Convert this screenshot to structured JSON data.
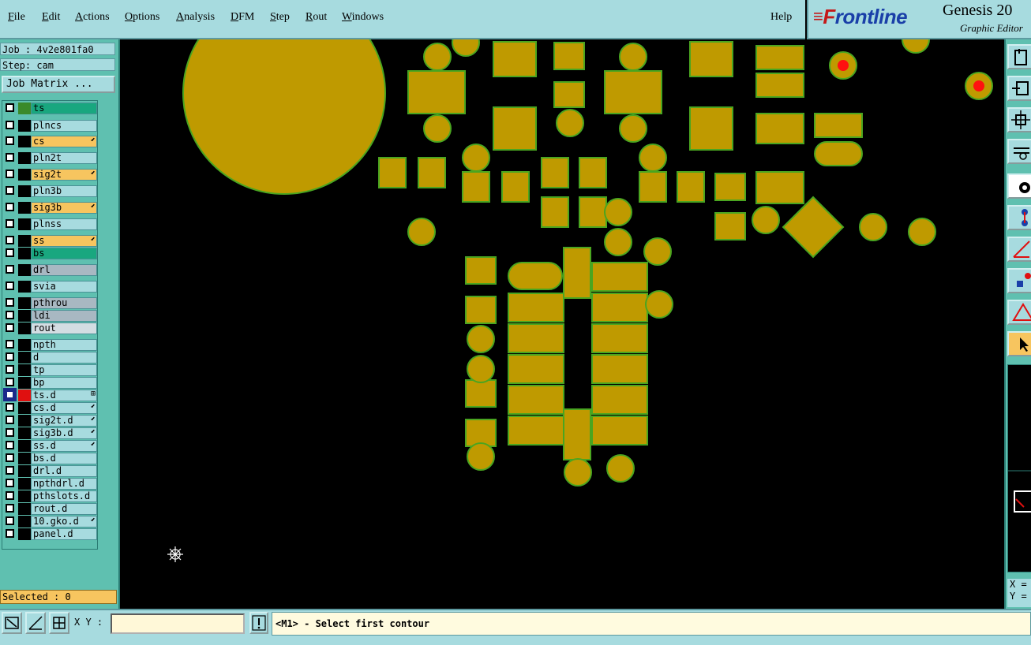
{
  "menubar": {
    "items": [
      {
        "label": "File",
        "u": "F",
        "rest": "ile"
      },
      {
        "label": "Edit",
        "u": "E",
        "rest": "dit"
      },
      {
        "label": "Actions",
        "u": "A",
        "rest": "ctions"
      },
      {
        "label": "Options",
        "u": "O",
        "rest": "ptions"
      },
      {
        "label": "Analysis",
        "u": "A",
        "rest": "nalysis"
      },
      {
        "label": "DFM",
        "u": "D",
        "rest": "FM"
      },
      {
        "label": "Step",
        "u": "S",
        "rest": "tep"
      },
      {
        "label": "Rout",
        "u": "R",
        "rest": "out"
      },
      {
        "label": "Windows",
        "u": "W",
        "rest": "indows"
      }
    ],
    "help": "Help"
  },
  "brand": {
    "logo_first": "F",
    "logo_rest": "rontline",
    "title": "Genesis 20",
    "subtitle": "Graphic Editor"
  },
  "job": {
    "job_line": "Job : 4v2e801fa0",
    "step_line": "Step: cam",
    "matrix_button": "Job Matrix ..."
  },
  "layers": [
    {
      "name": "ts",
      "style": "green",
      "swatch": "#3a8a2a",
      "mark": ""
    },
    {
      "name": "plncs",
      "style": "",
      "swatch": "#000000",
      "mark": ""
    },
    {
      "name": "cs",
      "style": "orange",
      "swatch": "#000000",
      "mark": "⬋"
    },
    {
      "name": "pln2t",
      "style": "",
      "swatch": "#000000",
      "mark": ""
    },
    {
      "name": "sig2t",
      "style": "orange",
      "swatch": "#000000",
      "mark": "⬋"
    },
    {
      "name": "pln3b",
      "style": "",
      "swatch": "#000000",
      "mark": ""
    },
    {
      "name": "sig3b",
      "style": "orange",
      "swatch": "#000000",
      "mark": "⬋"
    },
    {
      "name": "plnss",
      "style": "",
      "swatch": "#000000",
      "mark": ""
    },
    {
      "name": "ss",
      "style": "orange",
      "swatch": "#000000",
      "mark": "⬋"
    },
    {
      "name": "bs",
      "style": "green",
      "swatch": "#000000",
      "mark": ""
    },
    {
      "name": "drl",
      "style": "grey",
      "swatch": "#000000",
      "mark": ""
    },
    {
      "name": "svia",
      "style": "",
      "swatch": "#000000",
      "mark": ""
    },
    {
      "name": "pthrou",
      "style": "grey",
      "swatch": "#000000",
      "mark": ""
    },
    {
      "name": "ldi",
      "style": "grey",
      "swatch": "#000000",
      "mark": ""
    },
    {
      "name": "rout",
      "style": "lgrey",
      "swatch": "#000000",
      "mark": ""
    },
    {
      "name": "npth",
      "style": "",
      "swatch": "#000000",
      "mark": ""
    },
    {
      "name": "d",
      "style": "",
      "swatch": "#000000",
      "mark": ""
    },
    {
      "name": "tp",
      "style": "",
      "swatch": "#000000",
      "mark": ""
    },
    {
      "name": "bp",
      "style": "",
      "swatch": "#000000",
      "mark": ""
    },
    {
      "name": "ts.d",
      "style": "",
      "swatch": "#e01010",
      "mark": "⊞",
      "active": true
    },
    {
      "name": "cs.d",
      "style": "",
      "swatch": "#000000",
      "mark": "⬋"
    },
    {
      "name": "sig2t.d",
      "style": "",
      "swatch": "#000000",
      "mark": "⬋"
    },
    {
      "name": "sig3b.d",
      "style": "",
      "swatch": "#000000",
      "mark": "⬋"
    },
    {
      "name": "ss.d",
      "style": "",
      "swatch": "#000000",
      "mark": "⬋"
    },
    {
      "name": "bs.d",
      "style": "",
      "swatch": "#000000",
      "mark": ""
    },
    {
      "name": "drl.d",
      "style": "",
      "swatch": "#000000",
      "mark": ""
    },
    {
      "name": "npthdrl.d",
      "style": "",
      "swatch": "#000000",
      "mark": ""
    },
    {
      "name": "pthslots.d",
      "style": "",
      "swatch": "#000000",
      "mark": ""
    },
    {
      "name": "rout.d",
      "style": "",
      "swatch": "#000000",
      "mark": ""
    },
    {
      "name": "10.gko.d",
      "style": "",
      "swatch": "#000000",
      "mark": "⬋"
    },
    {
      "name": "panel.d",
      "style": "",
      "swatch": "#000000",
      "mark": ""
    }
  ],
  "selected": "Selected : 0",
  "coords": {
    "x": "X =",
    "y": "Y ="
  },
  "bottom": {
    "xy_label": "X Y :",
    "xy_value": "",
    "status": "<M1> - Select first contour"
  },
  "colors": {
    "pad": "#bf9a00",
    "pad_outline": "#4aa520",
    "drill": "#ff1010",
    "panel_bg": "#5fc0b0",
    "bar_bg": "#a7dbdf"
  },
  "icons": [
    "cursor-crosshair-icon",
    "arrow-pointer-icon"
  ]
}
